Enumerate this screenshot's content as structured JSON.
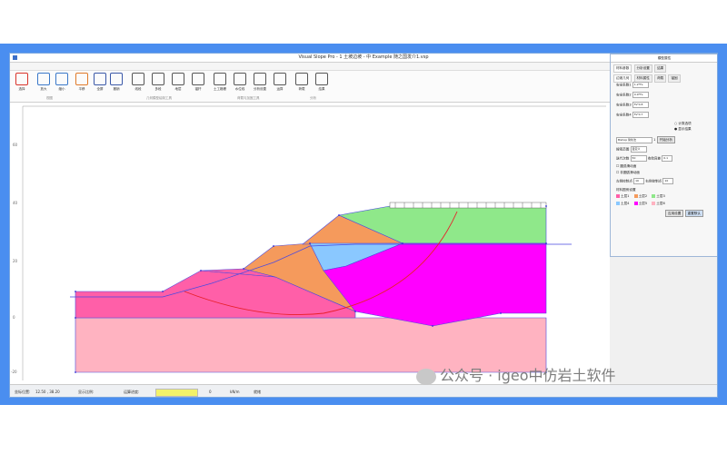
{
  "window": {
    "title": "Visual Slope Pro - 1 土坡边坡 - 中 Example 随之国发介1.vsp"
  },
  "menu": {
    "items": [
      "文件与设置",
      "岩体分析",
      "力学模型",
      "工况工具",
      "帮助",
      "截面图形分析"
    ],
    "active_index": 2
  },
  "ribbon": {
    "tools": [
      {
        "label": "选择",
        "icon": "pointer-icon",
        "color": "#d9342b"
      },
      {
        "label": "放大",
        "icon": "zoom-in-icon",
        "color": "#3a78c9"
      },
      {
        "label": "缩小",
        "icon": "zoom-out-icon",
        "color": "#3a78c9"
      },
      {
        "label": "平移",
        "icon": "pan-icon",
        "color": "#e07a2a"
      },
      {
        "label": "全屏",
        "icon": "fit-icon",
        "color": "#3a58a8"
      },
      {
        "label": "撤销",
        "icon": "undo-icon",
        "color": "#3a58a8"
      },
      {
        "label": "线段",
        "icon": "line-icon",
        "color": "#555"
      },
      {
        "label": "多段",
        "icon": "polyline-icon",
        "color": "#555"
      },
      {
        "label": "地层",
        "icon": "layer-icon",
        "color": "#555"
      },
      {
        "label": "锚杆",
        "icon": "anchor-icon",
        "color": "#555"
      },
      {
        "label": "土工格栅",
        "icon": "geogrid-icon",
        "color": "#555"
      },
      {
        "label": "水位线",
        "icon": "waterline-icon",
        "color": "#555"
      },
      {
        "label": "分析设置",
        "icon": "settings-icon",
        "color": "#555"
      },
      {
        "label": "运算",
        "icon": "run-icon",
        "color": "#555"
      },
      {
        "label": "荷载",
        "icon": "load-icon",
        "color": "#555"
      },
      {
        "label": "结果",
        "icon": "result-icon",
        "color": "#555"
      }
    ],
    "groups": [
      "视图",
      "几何模型绘制工具",
      "荷载与加固工具",
      "分析"
    ]
  },
  "axis": {
    "y_ticks": [
      "60",
      "40",
      "20",
      "0",
      "-20"
    ]
  },
  "panel": {
    "title": "模型属性",
    "tabs": [
      "材料参数",
      "分析设置",
      "结果"
    ],
    "subtabs": [
      "边坡几何",
      "材料属性",
      "荷载",
      "锚固"
    ],
    "fields": [
      {
        "label": "安全系数1",
        "value": "1.2*Fs"
      },
      {
        "label": "安全系数2",
        "value": "0.9*Fs"
      },
      {
        "label": "安全系数3",
        "value": "Fs*0.8"
      },
      {
        "label": "安全系数4",
        "value": "Fs*0.7"
      }
    ],
    "check_a": "计算选项",
    "check_b": "显示结果",
    "method_label": "Bishop 简化法",
    "method_value": "1",
    "compute_button": "开始分析",
    "search_label": "搜索范围",
    "search_value": "自定义",
    "iter_label": "迭代次数",
    "iter_value": "50",
    "tol_label": "收敛容差",
    "tol_value": "0.1",
    "opt_a": "圆弧滑动面",
    "opt_b": "非圆弧滑动面",
    "left_label": "左侧控制点",
    "left_value": "10",
    "right_label": "右侧控制点",
    "right_value": "10",
    "legend_title": "材料图例设置",
    "legend": [
      {
        "name": "土层1",
        "color": "#ff5fa8"
      },
      {
        "name": "土层2",
        "color": "#f59a5c"
      },
      {
        "name": "土层3",
        "color": "#8fe88a"
      },
      {
        "name": "土层4",
        "color": "#8ac8ff"
      },
      {
        "name": "土层5",
        "color": "#ff00ff"
      },
      {
        "name": "土层6",
        "color": "#ffb3c1"
      }
    ],
    "btn_a": "应用设置",
    "btn_b": "重置默认"
  },
  "status": {
    "coord_label": "坐标位置:",
    "coord_value": "12.50 , 38.20",
    "zoom_label": "显示比例:",
    "progress_label": "运算进度:",
    "progress_value": "0",
    "unit": "kN/m",
    "mode": "就绪"
  },
  "watermark": "公众号 · igeo中仿岩土软件"
}
